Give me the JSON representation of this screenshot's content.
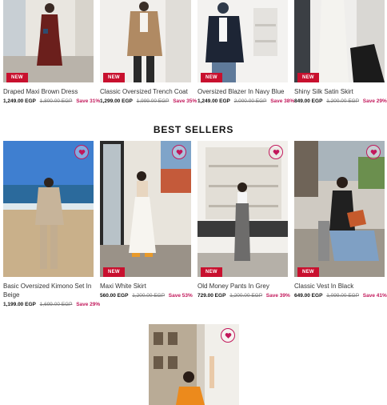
{
  "top_products": [
    {
      "name": "Draped Maxi Brown Dress",
      "badge": "NEW",
      "price": "1,249.00 EGP",
      "old_price": "1,800.00 EGP",
      "save": "Save 31%"
    },
    {
      "name": "Classic Oversized Trench Coat",
      "badge": "NEW",
      "price": "1,299.00 EGP",
      "old_price": "1,999.00 EGP",
      "save": "Save 35%"
    },
    {
      "name": "Oversized Blazer In Navy Blue",
      "badge": "NEW",
      "price": "1,249.00 EGP",
      "old_price": "2,000.00 EGP",
      "save": "Save 38%"
    },
    {
      "name": "Shiny Silk Satin Skirt",
      "badge": "NEW",
      "price": "849.00 EGP",
      "old_price": "1,200.00 EGP",
      "save": "Save 29%"
    }
  ],
  "best_sellers": {
    "title": "BEST SELLERS",
    "products": [
      {
        "name": "Basic Oversized Kimono Set In Beige",
        "badge": "",
        "price": "1,199.00 EGP",
        "old_price": "1,699.00 EGP",
        "save": "Save 29%"
      },
      {
        "name": "Maxi White Skirt",
        "badge": "NEW",
        "price": "560.00 EGP",
        "old_price": "1,200.00 EGP",
        "save": "Save 53%"
      },
      {
        "name": "Old Money Pants In Grey",
        "badge": "NEW",
        "price": "729.00 EGP",
        "old_price": "1,200.00 EGP",
        "save": "Save 39%"
      },
      {
        "name": "Classic Vest In Black",
        "badge": "NEW",
        "price": "649.00 EGP",
        "old_price": "1,099.00 EGP",
        "save": "Save 41%"
      }
    ]
  },
  "icons": {
    "wishlist": "heart-icon"
  },
  "colors": {
    "badge": "#c8102e",
    "save": "#c2185b",
    "heart": "#c2185b"
  }
}
